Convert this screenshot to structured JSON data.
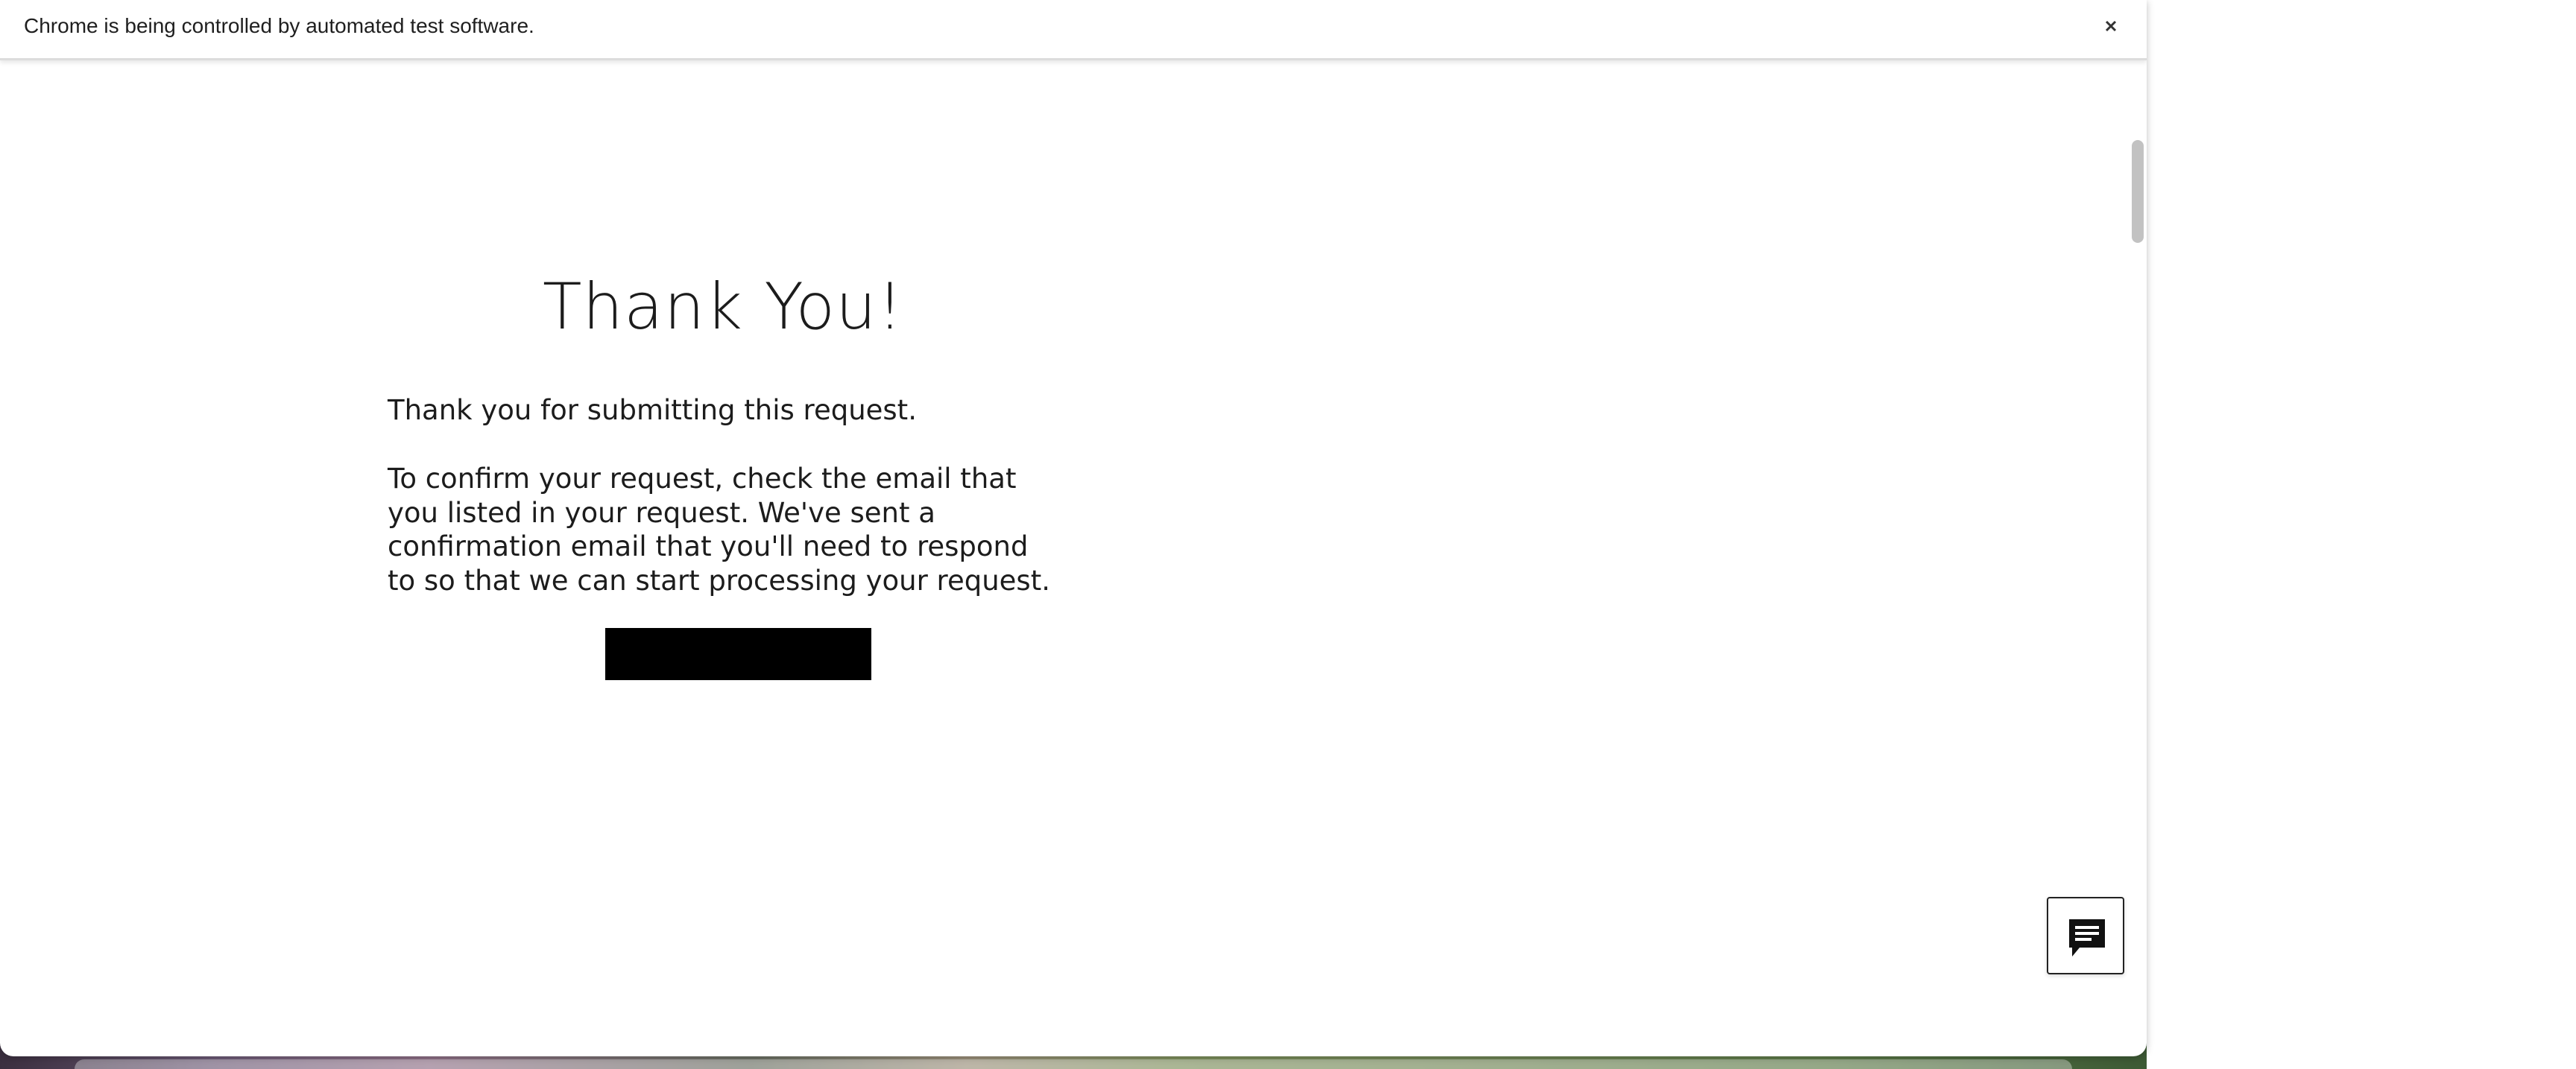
{
  "browser": {
    "automation_banner": "Chrome is being controlled by automated test software.",
    "close_icon": "close-icon"
  },
  "page": {
    "title": "Thank You!",
    "thanks_line": "Thank you for submitting this request.",
    "confirm_paragraph": "To confirm your request, check the email that you listed in your request. We've sent a confirmation email that you'll need to respond to so that we can start processing your request.",
    "button_color": "#000000"
  },
  "chat_widget": {
    "icon": "chat-icon"
  }
}
